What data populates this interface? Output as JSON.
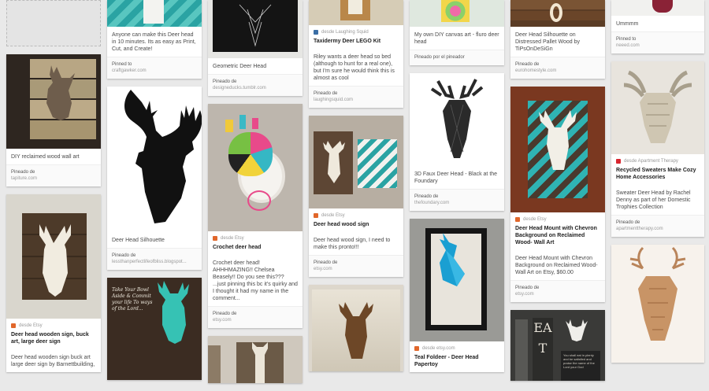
{
  "pins": {
    "c2a": {
      "desc": "Anyone can make this Deer head in 10 minutes. Its as easy as Print, Cut, and Create!",
      "src_label": "Pinned to",
      "src_value": "craftgawker.com"
    },
    "c1b": {
      "desc": "DIY reclaimed wood wall art",
      "src_label": "Pineado de",
      "src_value": "tapiture.com"
    },
    "c1c": {
      "via": "desde Etsy",
      "title": "Deer head wooden sign, buck art, large deer sign",
      "desc": "Deer head wooden sign buck art large deer sign by Barnettbuilding,"
    },
    "c2b": {
      "desc": "Deer Head Silhouette",
      "src_label": "Pineado de",
      "src_value": "lessthanperfectlifeofbliss.blogspot..."
    },
    "c3a": {
      "desc": "Geometric Deer Head",
      "src_label": "Pineado de",
      "src_value": "designeducks.tumblr.com"
    },
    "c3b": {
      "via": "desde Etsy",
      "title": "Crochet deer head",
      "desc": "Crochet deer head! AHHHMAZING!! Chelsea Beasely!! Do you see this??? ...just pinning this bc it's quirky and I thought it had my name in the comment...",
      "src_label": "Pineado de",
      "src_value": "etsy.com"
    },
    "c4a": {
      "via": "desde Laughing Squid",
      "title": "Taxidermy Deer LEGO Kit",
      "desc": "Riley wants a deer head so bed (although to hunt for a real one), but I'm sure he would think this is almost as cool",
      "src_label": "Pineado de",
      "src_value": "laughingsquid.com"
    },
    "c4b": {
      "via": "desde Etsy",
      "title": "Deer head wood sign",
      "desc": "Deer head wood sign, I need to make this pronto!!!",
      "src_label": "Pineado de",
      "src_value": "etsy.com"
    },
    "c5a": {
      "desc": "My own DIY canvas art - fluro deer head",
      "src_line": "Pineado por el pineador"
    },
    "c5b": {
      "desc": "3D Faux Deer Head - Black at the Foundary",
      "src_label": "Pineado de",
      "src_value": "thefoundary.com"
    },
    "c5c": {
      "via": "desde etsy.com",
      "title": "Teal Foldeer - Deer Head Papertoy"
    },
    "c6a": {
      "desc": "Deer Head Silhouette on Distressed Pallet Wood by TiPsOnDeSiGn",
      "src_label": "Pineado de",
      "src_value": "eurohomestyle.com"
    },
    "c6b": {
      "via": "desde Etsy",
      "title": "Deer Head Mount with Chevron Background on Reclaimed Wood- Wall Art",
      "desc": "Deer Head Mount with Chevron Background on Reclaimed Wood- Wall Art on Etsy, $60.00",
      "src_label": "Pineado de",
      "src_value": "etsy.com"
    },
    "c7a": {
      "desc": "Ummmm",
      "src_label": "Pinned to",
      "src_value": "neeed.com"
    },
    "c7b": {
      "via": "desde Apartment Therapy",
      "title": "Recycled Sweaters Make Cozy Home Accessories",
      "desc": "Sweater Deer Head by Rachel Denny as part of her Domestic Trophies Collection",
      "src_label": "Pineado de",
      "src_value": "apartmenttherapy.com"
    }
  },
  "image_text": {
    "chalk": "Take Your Bowl Aside & Commit your life To ways of the Lord...",
    "eat": "EAT",
    "small_note": "You shall eat in plenty and be satisfied and praise the name of the Lord your God"
  },
  "colors": {
    "etsy": "#e1672b",
    "teal": "#2fb3b3",
    "wood": "#6b4a30"
  }
}
